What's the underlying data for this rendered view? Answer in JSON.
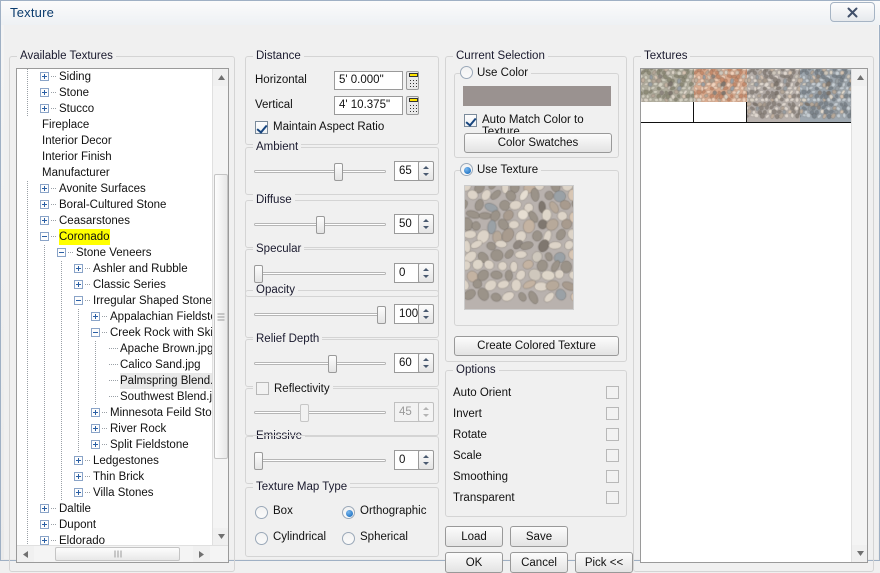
{
  "window": {
    "title": "Texture",
    "close_icon": "close-icon"
  },
  "tree_panel": {
    "legend": "Available Textures",
    "nodes": [
      {
        "label": "Siding",
        "depth": 1,
        "toggle": "plus"
      },
      {
        "label": "Stone",
        "depth": 1,
        "toggle": "plus"
      },
      {
        "label": "Stucco",
        "depth": 1,
        "toggle": "plus"
      },
      {
        "label": "Fireplace",
        "depth": 0,
        "toggle": "none"
      },
      {
        "label": "Interior Decor",
        "depth": 0,
        "toggle": "none"
      },
      {
        "label": "Interior Finish",
        "depth": 0,
        "toggle": "none"
      },
      {
        "label": "Manufacturer",
        "depth": 0,
        "toggle": "none"
      },
      {
        "label": "Avonite Surfaces",
        "depth": 1,
        "toggle": "plus"
      },
      {
        "label": "Boral-Cultured Stone",
        "depth": 1,
        "toggle": "plus"
      },
      {
        "label": "Ceasarstones",
        "depth": 1,
        "toggle": "plus"
      },
      {
        "label": "Coronado",
        "depth": 1,
        "toggle": "minus",
        "state": "highlighted"
      },
      {
        "label": "Stone Veneers",
        "depth": 2,
        "toggle": "minus"
      },
      {
        "label": "Ashler and Rubble",
        "depth": 3,
        "toggle": "plus"
      },
      {
        "label": "Classic Series",
        "depth": 3,
        "toggle": "plus"
      },
      {
        "label": "Irregular Shaped Stones",
        "depth": 3,
        "toggle": "minus"
      },
      {
        "label": "Appalachian Fieldstone",
        "depth": 4,
        "toggle": "plus"
      },
      {
        "label": "Creek Rock with Skipp",
        "depth": 4,
        "toggle": "minus"
      },
      {
        "label": "Apache Brown.jpg",
        "depth": 5,
        "toggle": "leaf"
      },
      {
        "label": "Calico Sand.jpg",
        "depth": 5,
        "toggle": "leaf"
      },
      {
        "label": "Palmspring Blend.jp",
        "depth": 5,
        "toggle": "leaf",
        "state": "selected"
      },
      {
        "label": "Southwest Blend.jp",
        "depth": 5,
        "toggle": "leaf"
      },
      {
        "label": "Minnesota Feild Stone",
        "depth": 4,
        "toggle": "plus"
      },
      {
        "label": "River Rock",
        "depth": 4,
        "toggle": "plus"
      },
      {
        "label": "Split Fieldstone",
        "depth": 4,
        "toggle": "plus"
      },
      {
        "label": "Ledgestones",
        "depth": 3,
        "toggle": "plus"
      },
      {
        "label": "Thin Brick",
        "depth": 3,
        "toggle": "plus"
      },
      {
        "label": "Villa Stones",
        "depth": 3,
        "toggle": "plus"
      },
      {
        "label": "Daltile",
        "depth": 1,
        "toggle": "plus"
      },
      {
        "label": "Dupont",
        "depth": 1,
        "toggle": "plus"
      },
      {
        "label": "Eldorado",
        "depth": 1,
        "toggle": "plus"
      }
    ]
  },
  "distance": {
    "legend": "Distance",
    "horizontal_label": "Horizontal",
    "horizontal_value": "5' 0.000\"",
    "vertical_label": "Vertical",
    "vertical_value": "4' 10.375\"",
    "maintain_aspect_label": "Maintain Aspect Ratio",
    "maintain_aspect_checked": true,
    "calculator_icon": "calculator-icon"
  },
  "sliders": [
    {
      "name": "ambient",
      "legend": "Ambient",
      "value": "65",
      "percent": 65,
      "enabled": true
    },
    {
      "name": "diffuse",
      "legend": "Diffuse",
      "value": "50",
      "percent": 50,
      "enabled": true
    },
    {
      "name": "specular",
      "legend": "Specular",
      "value": "0",
      "percent": 0,
      "enabled": true
    },
    {
      "name": "opacity",
      "legend": "Opacity",
      "value": "100",
      "percent": 100,
      "enabled": true
    },
    {
      "name": "relief",
      "legend": "Relief Depth",
      "value": "60",
      "percent": 60,
      "enabled": true
    },
    {
      "name": "emissive",
      "legend": "Emissive",
      "value": "0",
      "percent": 0,
      "enabled": true
    }
  ],
  "reflectivity": {
    "legend": "Reflectivity",
    "checked": false,
    "enabled": false,
    "value": "45",
    "percent": 37
  },
  "texture_map_type": {
    "legend": "Texture Map Type",
    "options": [
      {
        "label": "Box",
        "selected": false
      },
      {
        "label": "Orthographic",
        "selected": true
      },
      {
        "label": "Cylindrical",
        "selected": false
      },
      {
        "label": "Spherical",
        "selected": false
      }
    ]
  },
  "current_selection": {
    "legend": "Current Selection",
    "use_color_label": "Use Color",
    "use_color_selected": false,
    "color_value": "#9a9290",
    "auto_match_label": "Auto Match Color to Texture",
    "auto_match_checked": true,
    "color_swatches_button": "Color Swatches",
    "use_texture_label": "Use Texture",
    "use_texture_selected": true,
    "create_colored_texture_button": "Create Colored Texture"
  },
  "options": {
    "legend": "Options",
    "items": [
      {
        "label": "Auto Orient",
        "checked": false
      },
      {
        "label": "Invert",
        "checked": false
      },
      {
        "label": "Rotate",
        "checked": false
      },
      {
        "label": "Scale",
        "checked": false
      },
      {
        "label": "Smoothing",
        "checked": false
      },
      {
        "label": "Transparent",
        "checked": false
      }
    ]
  },
  "buttons": {
    "load": "Load",
    "save": "Save",
    "ok": "OK",
    "cancel": "Cancel",
    "pick": "Pick <<"
  },
  "textures_panel": {
    "legend": "Textures",
    "thumbnails": [
      {
        "name": "thumb-1",
        "selected": false,
        "base": "#b3b0a0",
        "dot_a": "#8f8d79",
        "dot_b": "#d6d3c4"
      },
      {
        "name": "thumb-2",
        "selected": false,
        "base": "#dfae91",
        "dot_a": "#c98d6d",
        "dot_b": "#f3d3bc"
      },
      {
        "name": "thumb-3",
        "selected": true,
        "base": "#b9b2ae",
        "dot_a": "#8e867f",
        "dot_b": "#e2dad2"
      },
      {
        "name": "thumb-4",
        "selected": false,
        "base": "#9fa8b0",
        "dot_a": "#7d868e",
        "dot_b": "#c8d0d6"
      }
    ]
  }
}
